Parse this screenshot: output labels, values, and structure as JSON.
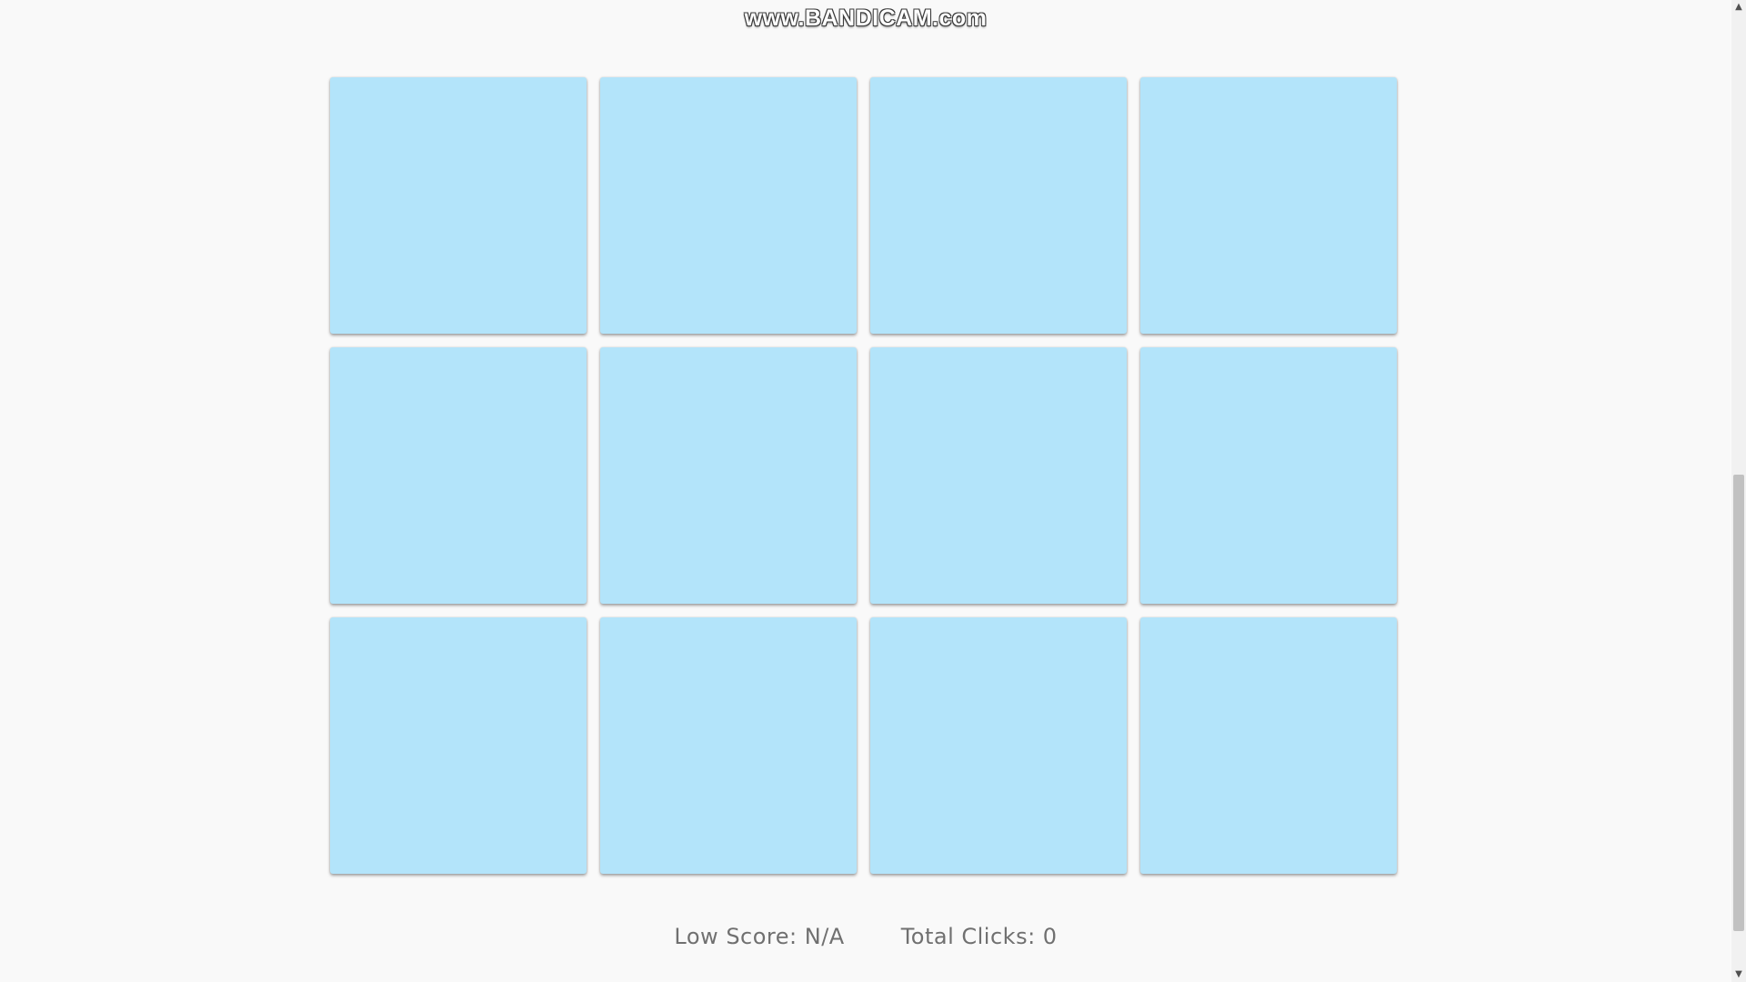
{
  "watermark": {
    "text": "www.BANDICAM.com"
  },
  "board": {
    "columns": 4,
    "rows": 3,
    "card_color": "#b3e4fa",
    "cards": [
      {
        "face": "hidden"
      },
      {
        "face": "hidden"
      },
      {
        "face": "hidden"
      },
      {
        "face": "hidden"
      },
      {
        "face": "hidden"
      },
      {
        "face": "hidden"
      },
      {
        "face": "hidden"
      },
      {
        "face": "hidden"
      },
      {
        "face": "hidden"
      },
      {
        "face": "hidden"
      },
      {
        "face": "hidden"
      },
      {
        "face": "hidden"
      }
    ]
  },
  "stats": {
    "low_score_label": "Low Score: N/A",
    "total_clicks_label": "Total Clicks: 0"
  },
  "scrollbar": {
    "up_icon": "chevron-up-icon",
    "down_icon": "chevron-down-icon"
  }
}
